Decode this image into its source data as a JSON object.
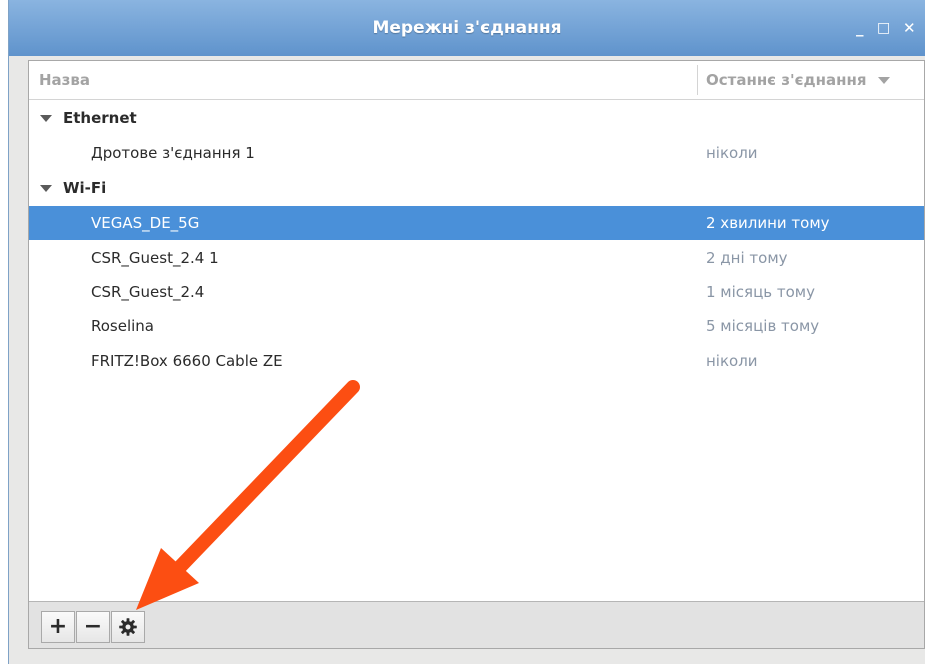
{
  "window": {
    "title": "Мережні з'єднання",
    "minimize_glyph": "_",
    "maximize_glyph": "□",
    "close_glyph": "✕"
  },
  "table": {
    "col_name": "Назва",
    "col_last": "Останнє з'єднання",
    "groups": [
      {
        "label": "Ethernet",
        "items": [
          {
            "name": "Дротове з'єднання 1",
            "last": "ніколи"
          }
        ]
      },
      {
        "label": "Wi-Fi",
        "items": [
          {
            "name": "VEGAS_DE_5G",
            "last": "2 хвилини тому",
            "selected": true
          },
          {
            "name": "CSR_Guest_2.4 1",
            "last": "2 дні тому"
          },
          {
            "name": "CSR_Guest_2.4",
            "last": "1 місяць тому"
          },
          {
            "name": "Roselina",
            "last": "5 місяців тому"
          },
          {
            "name": "FRITZ!Box 6660 Cable ZE",
            "last": "ніколи"
          }
        ]
      }
    ]
  },
  "toolbar": {
    "add_glyph": "+",
    "remove_glyph": "−"
  },
  "colors": {
    "titlebar": "#6a9bd2",
    "selection": "#4a90d9",
    "annotation_arrow": "#fc4e12"
  }
}
